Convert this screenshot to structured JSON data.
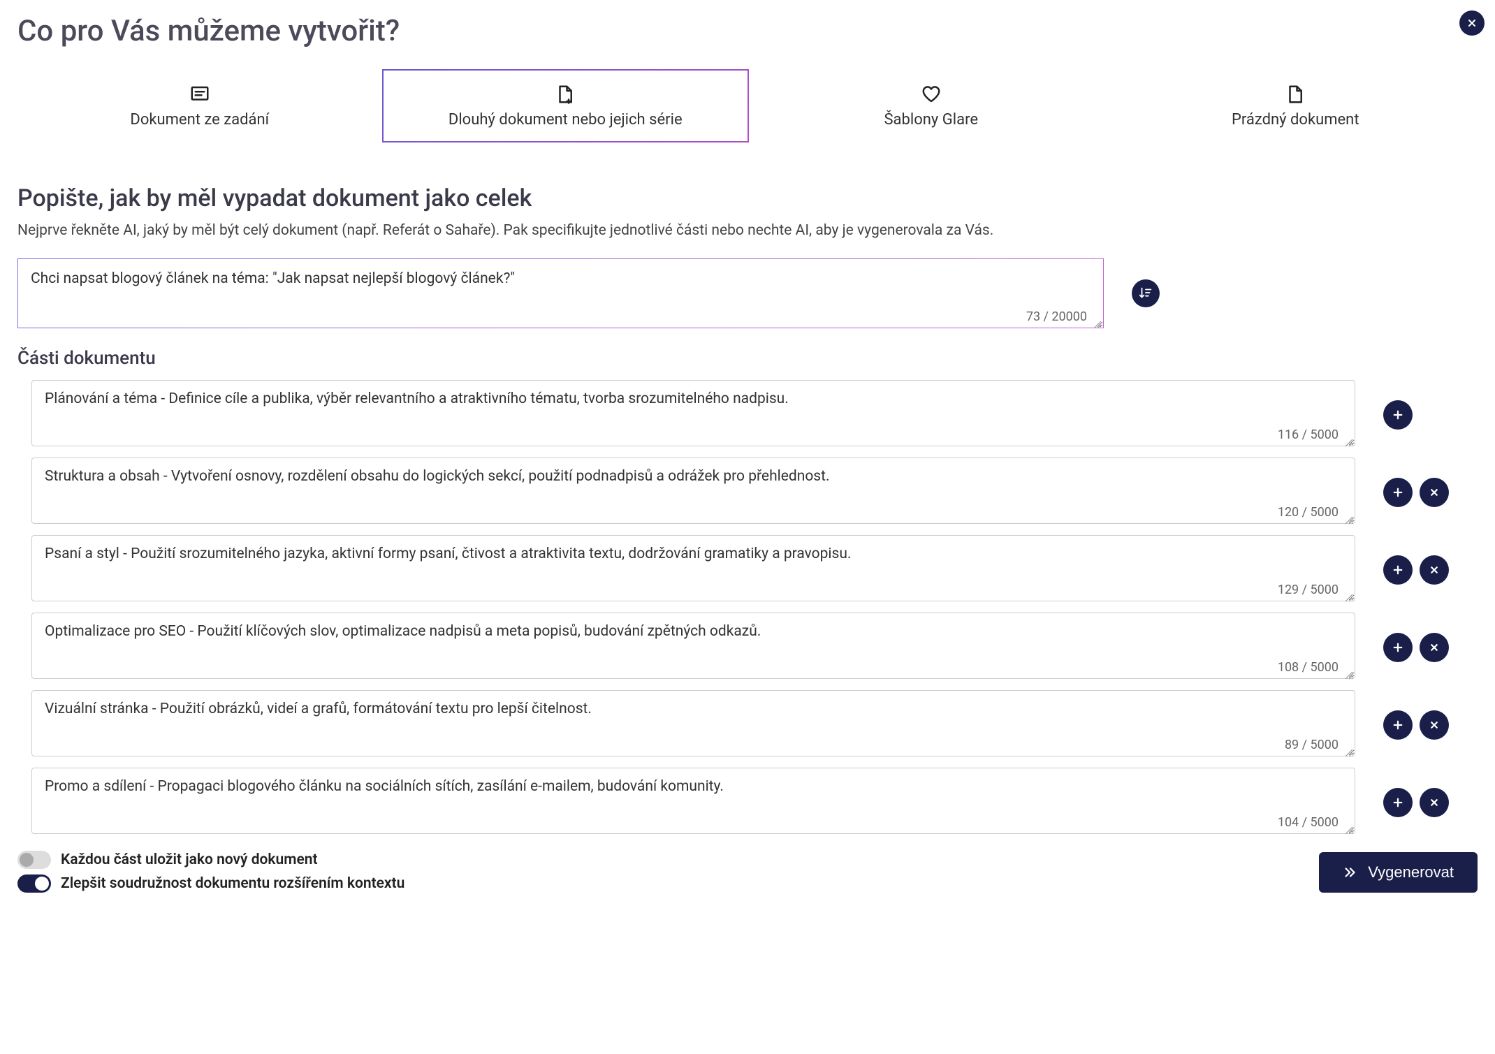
{
  "header": {
    "title": "Co pro Vás můžeme vytvořit?"
  },
  "tabs": [
    {
      "id": "from-prompt",
      "label": "Dokument ze zadání",
      "icon": "message-square-icon",
      "active": false
    },
    {
      "id": "long-doc",
      "label": "Dlouhý dokument nebo jejich série",
      "icon": "file-plus-icon",
      "active": true
    },
    {
      "id": "templates",
      "label": "Šablony Glare",
      "icon": "heart-icon",
      "active": false
    },
    {
      "id": "blank",
      "label": "Prázdný dokument",
      "icon": "file-icon",
      "active": false
    }
  ],
  "describe": {
    "title": "Popište, jak by měl vypadat dokument jako celek",
    "desc": "Nejprve řekněte AI, jaký by měl být celý dokument (např. Referát o Sahaře). Pak specifikujte jednotlivé části nebo nechte AI, aby je vygenerovala za Vás.",
    "value": "Chci napsat blogový článek na téma: \"Jak napsat nejlepší blogový článek?\"",
    "counter": "73 / 20000"
  },
  "parts": {
    "title": "Části dokumentu",
    "limit_suffix": " / 5000",
    "items": [
      {
        "value": "Plánování a téma - Definice cíle a publika, výběr relevantního a atraktivního tématu, tvorba srozumitelného nadpisu.",
        "count": "116",
        "removable": false
      },
      {
        "value": "Struktura a obsah - Vytvoření osnovy, rozdělení obsahu do logických sekcí, použití podnadpisů a odrážek pro přehlednost.",
        "count": "120",
        "removable": true
      },
      {
        "value": "Psaní a styl - Použití srozumitelného jazyka, aktivní formy psaní, čtivost a atraktivita textu, dodržování gramatiky a pravopisu.",
        "count": "129",
        "removable": true
      },
      {
        "value": "Optimalizace pro SEO - Použití klíčových slov, optimalizace nadpisů a meta popisů, budování zpětných odkazů.",
        "count": "108",
        "removable": true
      },
      {
        "value": "Vizuální stránka - Použití obrázků, videí a grafů, formátování textu pro lepší čitelnost.",
        "count": "89",
        "removable": true
      },
      {
        "value": "Promo a sdílení - Propagaci blogového článku na sociálních sítích, zasílání e-mailem, budování komunity.",
        "count": "104",
        "removable": true
      }
    ]
  },
  "toggles": {
    "save_each": {
      "label": "Každou část uložit jako nový dokument",
      "on": false
    },
    "improve_cohesion": {
      "label": "Zlepšit soudružnost dokumentu rozšířením kontextu",
      "on": true
    }
  },
  "generate_label": "Vygenerovat"
}
